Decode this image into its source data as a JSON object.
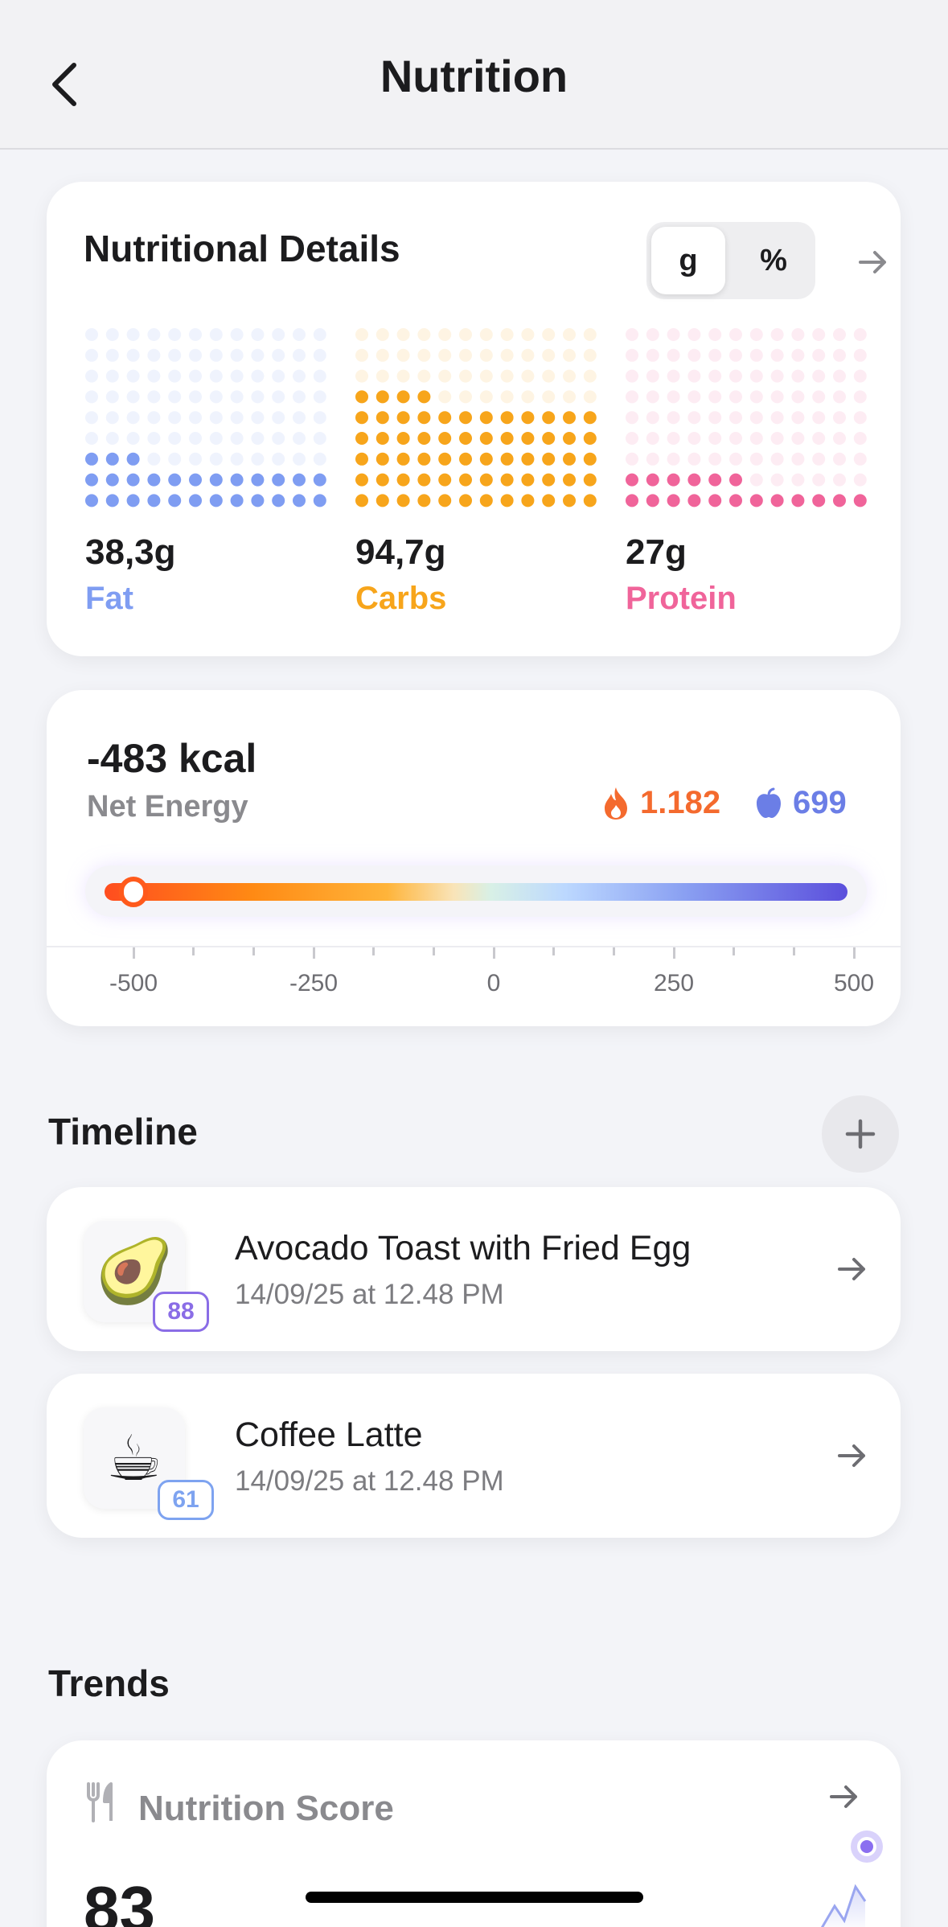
{
  "nav": {
    "title": "Nutrition",
    "back_icon": "chevron-left-icon"
  },
  "nutrition_details": {
    "title": "Nutritional Details",
    "unit_options": [
      "g",
      "%"
    ],
    "selected_unit": "g",
    "macros": [
      {
        "value": "38,3g",
        "label": "Fat",
        "color": "#7f9df2",
        "filled_dots": 27,
        "total_dots": 108
      },
      {
        "value": "94,7g",
        "label": "Carbs",
        "color": "#f7a51b",
        "filled_dots": 64,
        "total_dots": 108
      },
      {
        "value": "27g",
        "label": "Protein",
        "color": "#f0649a",
        "filled_dots": 18,
        "total_dots": 108
      }
    ]
  },
  "energy": {
    "value": "-483 kcal",
    "label": "Net Energy",
    "burned": "1.182",
    "eaten": "699",
    "burned_color": "#f46a2e",
    "eaten_color": "#6b7ee6",
    "net_value": -483,
    "range": [
      -500,
      500
    ],
    "tick_labels": [
      "-500",
      "-250",
      "0",
      "250",
      "500"
    ]
  },
  "timeline": {
    "title": "Timeline",
    "meals": [
      {
        "name": "Avocado Toast with Fried Egg",
        "time": "14/09/25 at 12.48 PM",
        "score": "88",
        "emoji": "🥑",
        "score_color": "#8a6de6"
      },
      {
        "name": "Coffee Latte",
        "time": "14/09/25 at 12.48 PM",
        "score": "61",
        "emoji": "☕",
        "score_color": "#7ea3f0"
      }
    ]
  },
  "trends": {
    "title": "Trends",
    "card_title": "Nutrition Score",
    "value": "83"
  }
}
